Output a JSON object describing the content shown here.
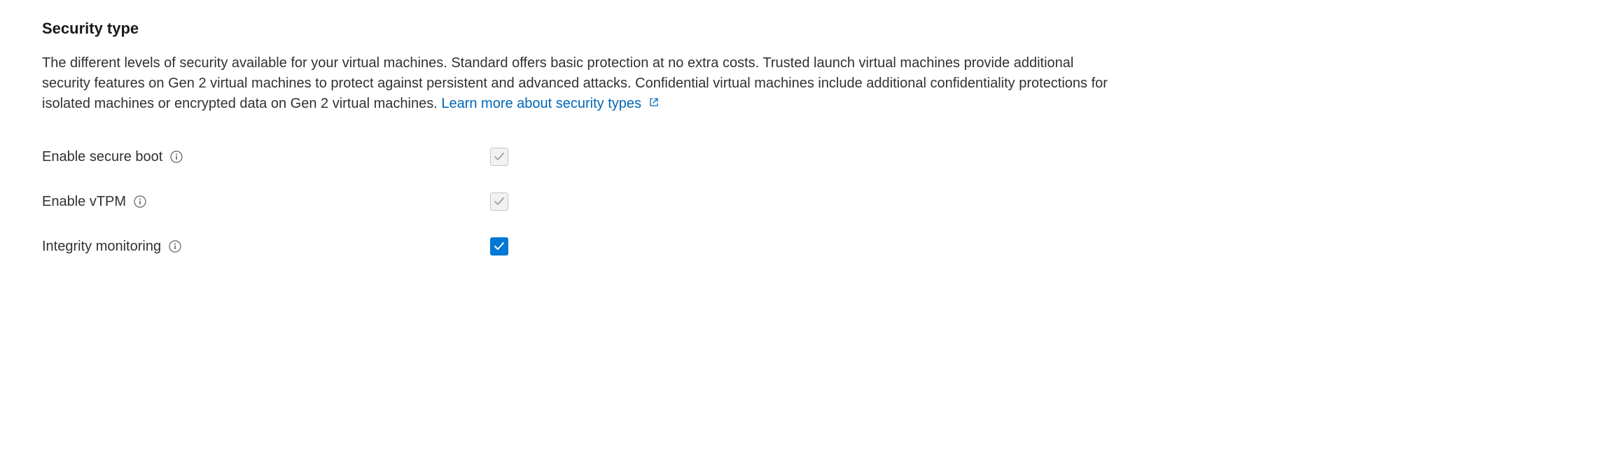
{
  "section": {
    "title": "Security type",
    "description": "The different levels of security available for your virtual machines. Standard offers basic protection at no extra costs. Trusted launch virtual machines provide additional security features on Gen 2 virtual machines to protect against persistent and advanced attacks. Confidential virtual machines include additional confidentiality protections for isolated machines or encrypted data on Gen 2 virtual machines.",
    "link_text": "Learn more about security types"
  },
  "fields": {
    "secure_boot": {
      "label": "Enable secure boot",
      "checked": true,
      "disabled": true
    },
    "vtpm": {
      "label": "Enable vTPM",
      "checked": true,
      "disabled": true
    },
    "integrity_monitoring": {
      "label": "Integrity monitoring",
      "checked": true,
      "disabled": false
    }
  }
}
